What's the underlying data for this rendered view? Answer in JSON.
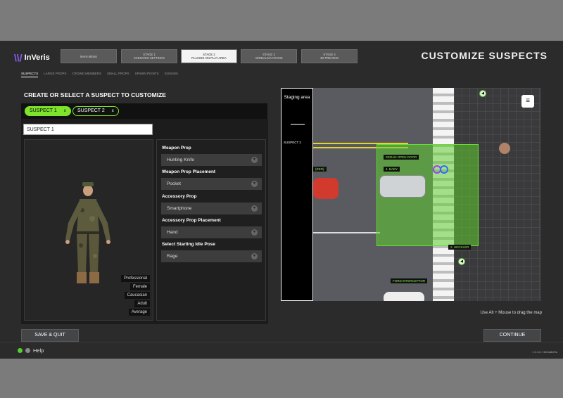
{
  "header": {
    "logo_mark": "\\\\/",
    "logo_text": "InVeris",
    "title": "CUSTOMIZE SUSPECTS",
    "stages": [
      {
        "line1": "MAIN MENU",
        "line2": ""
      },
      {
        "line1": "STAGE 1",
        "line2": "SCENARIO SETTINGS"
      },
      {
        "line1": "STAGE 2",
        "line2": "PLACING ON PLAY AREA"
      },
      {
        "line1": "STAGE 3",
        "line2": "VERBALS/ACTIONS"
      },
      {
        "line1": "STAGE 4",
        "line2": "3D PREVIEW"
      }
    ]
  },
  "subnav": [
    "SUSPECTS",
    "LARGE PROPS",
    "CROWD MEMBERS",
    "SMALL PROPS",
    "SPAWN POINTS",
    "SOUNDS"
  ],
  "section_title": "CREATE OR SELECT A SUSPECT TO CUSTOMIZE",
  "suspects": [
    {
      "label": "SUSPECT 1",
      "close": "x"
    },
    {
      "label": "SUSPECT 2",
      "close": "x"
    }
  ],
  "name_input": {
    "value": "SUSPECT 1"
  },
  "traits": [
    "Professional",
    "Female",
    "Caucasian",
    "Adult",
    "Average"
  ],
  "form": {
    "weapon_prop": {
      "label": "Weapon Prop",
      "value": "Hunting Knife"
    },
    "weapon_placement": {
      "label": "Weapon Prop Placement",
      "value": "Pocket"
    },
    "accessory_prop": {
      "label": "Accessory Prop",
      "value": "Smartphone"
    },
    "accessory_placement": {
      "label": "Accessory Prop Placement",
      "value": "Hand"
    },
    "idle_pose": {
      "label": "Select Starting Idle Pose",
      "value": "Rage"
    }
  },
  "map": {
    "staging_title": "Staging area",
    "staging_suspect": "SUSPECT 2",
    "tags": {
      "sedan": "SEDAN OPEN DOOR",
      "baby": "4. BABY",
      "red": "(RED)",
      "heckler": "2. HECKLER",
      "ford": "FORD INTERCEPTOR"
    },
    "hint": "Use Alt + Mouse to drag the map"
  },
  "footer": {
    "save_label": "SAVE & QUIT",
    "continue_label": "CONTINUE",
    "help_label": "Help",
    "version": "1.0.3.8 / 34f4a8ef9a"
  },
  "colors": {
    "accent": "#7ee32b",
    "zone": "#62e02c",
    "logo": "#8a5cf5"
  }
}
